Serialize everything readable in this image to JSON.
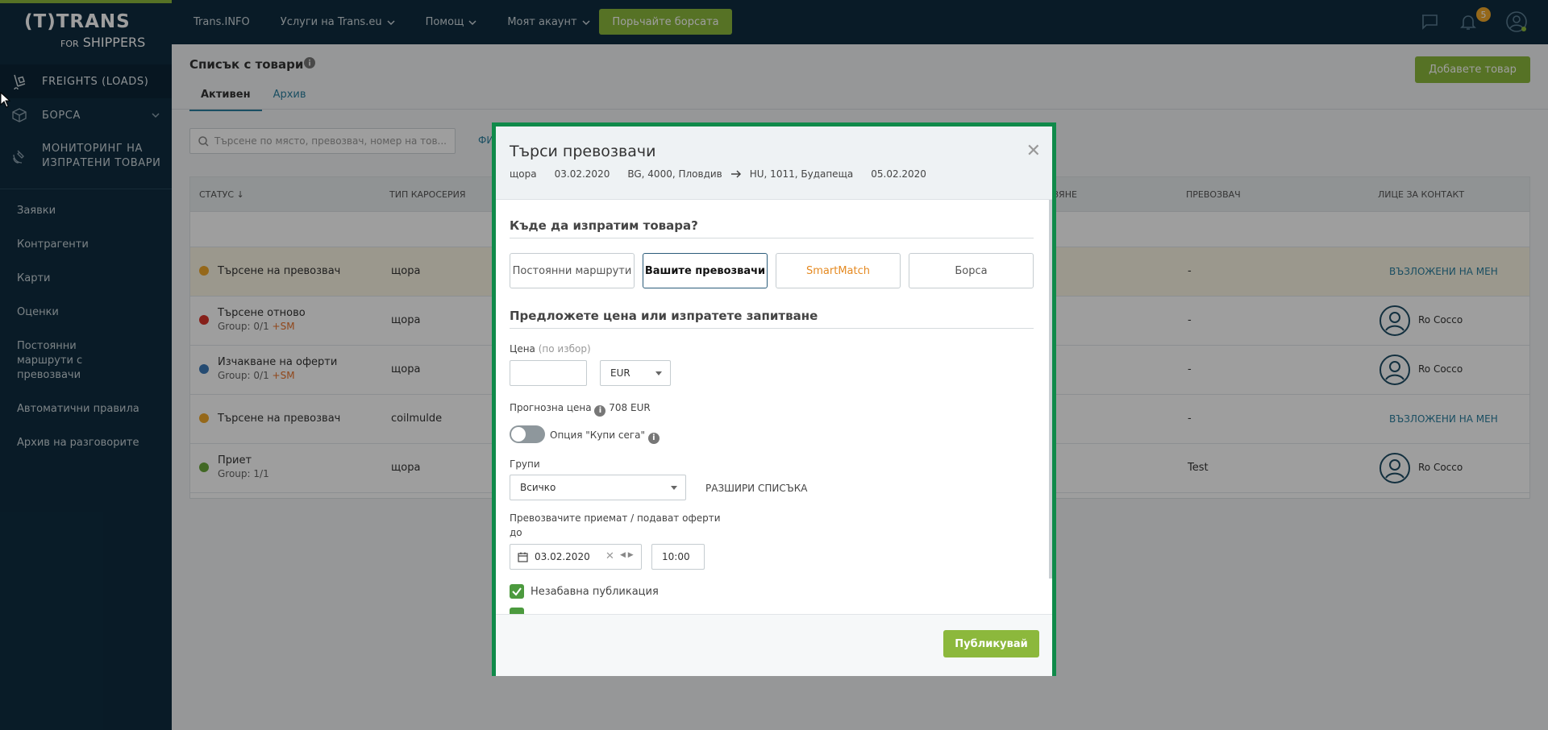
{
  "logo": {
    "line1": "(T)TRANS",
    "line2_small": "FOR",
    "line2": "SHIPPERS"
  },
  "sidebar": {
    "main": [
      {
        "label": "FREIGHTS (LOADS)"
      },
      {
        "label": "БОРСА"
      },
      {
        "label": "МОНИТОРИНГ НА",
        "label2": "ИЗПРАТЕНИ ТОВАРИ"
      }
    ],
    "links": [
      "Заявки",
      "Контрагенти",
      "Карти",
      "Оценки",
      "Постоянни маршрути с превозвачи",
      "Автоматични правила",
      "Архив на разговорите"
    ]
  },
  "topbar": {
    "nav": [
      "Trans.INFO",
      "Услуги на Trans.eu",
      "Помощ",
      "Моят акаунт"
    ],
    "cta": "Порьчайте борсата",
    "notifications": "5"
  },
  "page": {
    "title": "Списък с товари",
    "add_button": "Добавете товар",
    "tabs": [
      "Активен",
      "Архив"
    ],
    "search_placeholder": "Търсене по място, превозвач, номер на тов...",
    "filter": "ФИ"
  },
  "table": {
    "headers": [
      "СТАТУС",
      "ТИП КАРОСЕРИЯ",
      "ЗЯНЕ",
      "ПРЕВОЗВАЧ",
      "ЛИЦЕ ЗА КОНТАКТ"
    ],
    "rows": [
      {
        "status": "Търсене на превозвач",
        "sub": "",
        "sm": "",
        "body": "щора",
        "carrier": "-",
        "contact": "ВЪЗЛОЖЕНИ НА МЕН",
        "status_color": "#f0a92a"
      },
      {
        "status": "Търсене отново",
        "sub": "Group: 0/1",
        "sm": "+SM",
        "body": "щора",
        "carrier": "-",
        "contact": "Ro Cocco",
        "status_color": "#d9342b"
      },
      {
        "status": "Изчакване на оферти",
        "sub": "Group: 0/1",
        "sm": "+SM",
        "body": "щора",
        "carrier": "-",
        "contact": "Ro Cocco",
        "status_color": "#3d7ab8"
      },
      {
        "status": "Търсене на превозвач",
        "sub": "",
        "sm": "",
        "body": "coilmulde",
        "carrier": "-",
        "contact": "ВЪЗЛОЖЕНИ НА МЕН",
        "status_color": "#f0a92a"
      },
      {
        "status": "Приет",
        "sub": "Group: 1/1",
        "sm": "",
        "body": "щора",
        "carrier": "Test",
        "contact": "Ro Cocco",
        "status_color": "#6aa83b"
      }
    ]
  },
  "modal": {
    "title": "Търси превозвачи",
    "route": {
      "body": "щора",
      "date_from": "03.02.2020",
      "from": "BG, 4000, Пловдив",
      "to": "HU, 1011, Будапеща",
      "date_to": "05.02.2020"
    },
    "section1": "Къде да изпратим товара?",
    "options": [
      "Постоянни маршрути",
      "Вашите превозвачи",
      "SmartMatch",
      "Борса"
    ],
    "section2": "Предложете цена или изпратете запитване",
    "price_label": "Цена",
    "price_optional": "(по избор)",
    "price_value": "",
    "currency": "EUR",
    "forecast_label": "Прогнозна цена",
    "forecast_value": "708 EUR",
    "buy_now_label": "Опция \"Купи сега\"",
    "groups_label": "Групи",
    "groups_value": "Всичко",
    "expand_list": "РАЗШИРИ СПИСЪКА",
    "deadline_label1": "Превозвачите приемат / подават оферти",
    "deadline_label2": "до",
    "deadline_date": "03.02.2020",
    "deadline_time": "10:00",
    "immediate_publish": "Незабавна публикация",
    "publish_button": "Публикувай"
  },
  "colors": {
    "sidebar": "#0f2d40",
    "accent_green": "#8cb83c",
    "modal_border": "#108a4a",
    "link": "#2b7f9e"
  }
}
